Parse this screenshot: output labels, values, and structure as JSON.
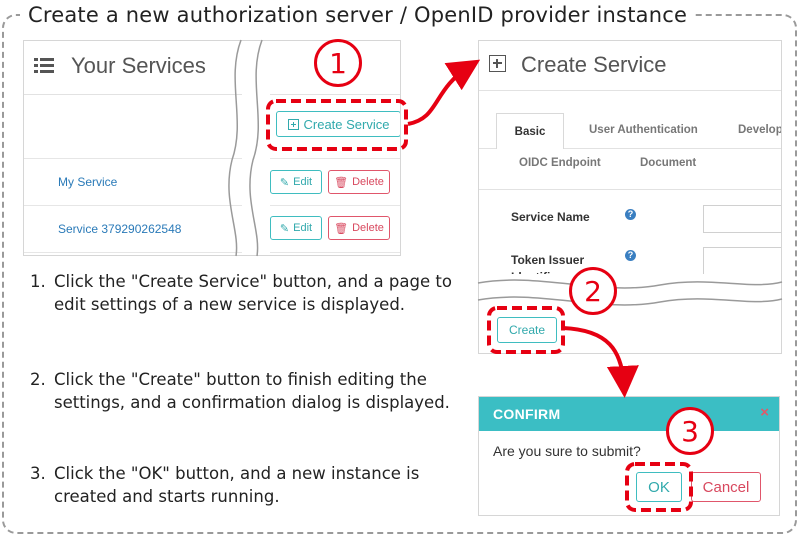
{
  "page": {
    "title": "Create a new authorization server / OpenID provider instance"
  },
  "services_panel": {
    "title": "Your Services",
    "create_service_label": "Create Service",
    "rows": [
      {
        "name": "My Service",
        "edit_label": "Edit",
        "delete_label": "Delete"
      },
      {
        "name": "Service 379290262548",
        "edit_label": "Edit",
        "delete_label": "Delete"
      }
    ]
  },
  "steps": [
    {
      "num": "1.",
      "text": "Click the \"Create Service\" button, and a page to edit settings of a new service is displayed."
    },
    {
      "num": "2.",
      "text": "Click the \"Create\" button to finish editing the settings, and a confirmation dialog is displayed."
    },
    {
      "num": "3.",
      "text": "Click the \"OK\" button, and a new instance is created and starts running."
    }
  ],
  "callouts": [
    "1",
    "2",
    "3"
  ],
  "create_panel": {
    "title": "Create Service",
    "tabs": [
      "Basic",
      "User Authentication",
      "Develop",
      "OIDC Endpoint",
      "Document"
    ],
    "fields": [
      {
        "label": "Service Name",
        "help": "?"
      },
      {
        "label": "Token Issuer Identifier",
        "help": "?"
      }
    ],
    "create_label": "Create"
  },
  "dialog": {
    "title": "CONFIRM",
    "close": "×",
    "message": "Are you sure to submit?",
    "ok_label": "OK",
    "cancel_label": "Cancel"
  },
  "colors": {
    "highlight": "#e60012",
    "teal": "#3bbec4",
    "danger": "#e0566b",
    "link": "#2a7ab8"
  },
  "icons": {
    "list": "list-icon",
    "plus_square": "plus-square-icon",
    "edit": "edit-icon",
    "trash": "trash-icon",
    "help": "question-circle-icon",
    "close": "close-icon"
  }
}
